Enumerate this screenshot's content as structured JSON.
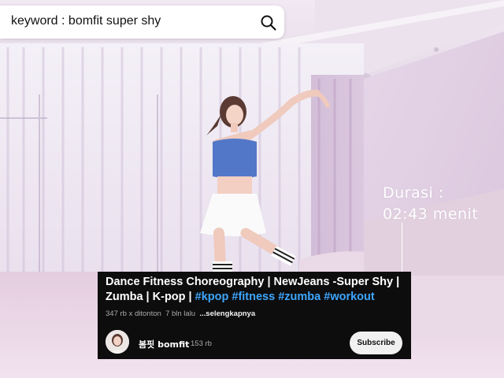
{
  "search": {
    "query": "keyword : bomfit super shy",
    "icon": "search-icon"
  },
  "duration": {
    "label": "Durasi :",
    "value": "02:43 menit"
  },
  "video": {
    "title_line1": "Dance Fitness Choreography | NewJeans -Super Shy |",
    "title_line2_plain": "Zumba | K-pop |",
    "hashtags": [
      "#kpop",
      "#fitness",
      "#zumba",
      "#workout"
    ],
    "views": "347 rb x ditonton",
    "age": "7 bln lalu",
    "more": "...selengkapnya"
  },
  "channel": {
    "name": "봄핏 bomfit",
    "subscribers": "153 rb",
    "subscribe_label": "Subscribe"
  },
  "colors": {
    "hashtag": "#3ea6ff",
    "card_bg": "#0d0d0d",
    "wall": "#e9dcea"
  }
}
